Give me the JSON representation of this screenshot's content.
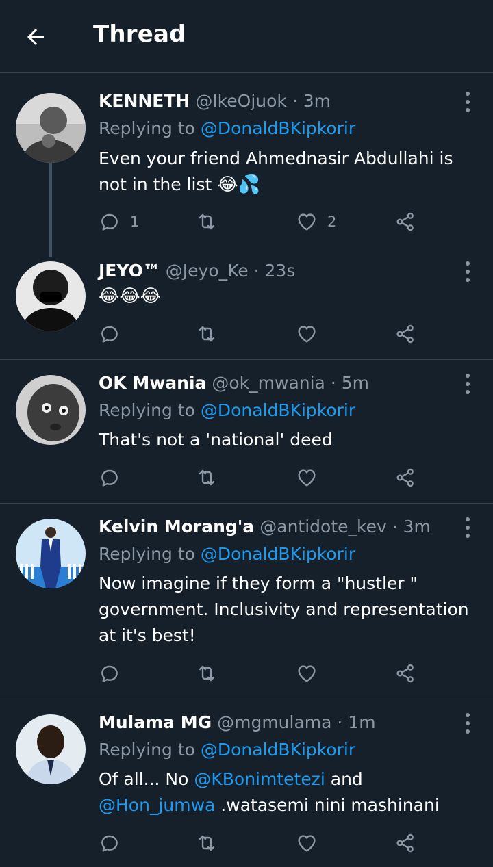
{
  "header": {
    "title": "Thread"
  },
  "tweets": [
    {
      "name": "KENNETH",
      "handle": "@IkeOjuok",
      "time": "3m",
      "replying_prefix": "Replying to ",
      "replying_to": "@DonaldBKipkorir",
      "text": "Even your friend Ahmednasir Abdullahi is\nnot in the list ",
      "emojis": "😂💦",
      "reply_count": "1",
      "like_count": "2",
      "avatar_icon": "person-photo"
    },
    {
      "name": "JEYO™",
      "handle": "@Jeyo_Ke",
      "time": "23s",
      "text": "😂😂😂",
      "avatar_icon": "person-photo"
    },
    {
      "name": "OK Mwania",
      "handle": "@ok_mwania",
      "time": "5m",
      "replying_prefix": "Replying to ",
      "replying_to": "@DonaldBKipkorir",
      "text": "That's not a 'national' deed",
      "avatar_icon": "baby-photo"
    },
    {
      "name": "Kelvin Morang'a",
      "handle": "@antidote_kev",
      "time": "3m",
      "replying_prefix": "Replying to ",
      "replying_to": "@DonaldBKipkorir",
      "text": "Now imagine if they form a \"hustler \"\ngovernment. Inclusivity and representation\nat it's best!",
      "avatar_icon": "person-suit-photo"
    },
    {
      "name": "Mulama MG",
      "handle": "@mgmulama",
      "time": "1m",
      "replying_prefix": "Replying to ",
      "replying_to": "@DonaldBKipkorir",
      "text_part1": "Of  all... No ",
      "mention1": "@KBonimtetezi",
      "text_part2": " and",
      "mention2": "@Hon_jumwa",
      "text_part3": " .watasemi nini mashinani",
      "avatar_icon": "person-photo"
    }
  ],
  "dot": "·",
  "colors": {
    "background": "#15202b",
    "divider": "#38444d",
    "secondary_text": "#8b98a5",
    "link": "#1d9bf0"
  },
  "icons": {
    "back": "arrow-left-icon",
    "more": "more-vertical-icon",
    "reply": "reply-icon",
    "retweet": "retweet-icon",
    "like": "heart-icon",
    "share": "share-icon"
  }
}
